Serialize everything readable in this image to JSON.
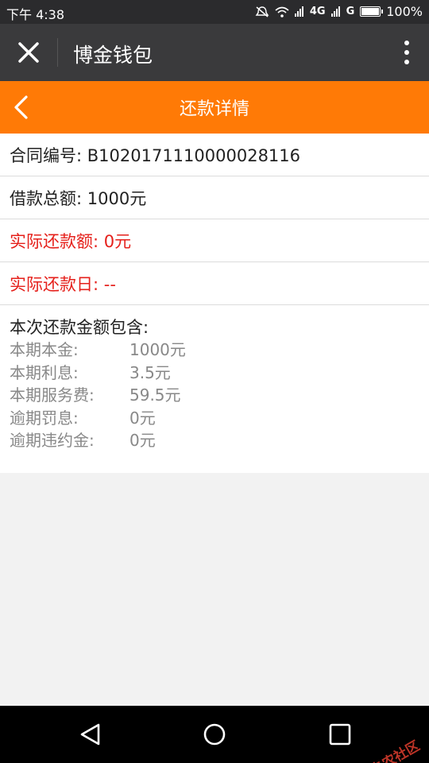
{
  "status_bar": {
    "time": "下午 4:38",
    "network_labels": [
      "4G",
      "G"
    ],
    "battery_level": 1.0,
    "battery_text": "100%"
  },
  "app_bar": {
    "close_icon": "close-icon",
    "title": "博金钱包",
    "more_icon": "more-vertical-icon"
  },
  "page_header": {
    "back_icon": "chevron-left-icon",
    "title": "还款详情",
    "color": "#ff7a06"
  },
  "details": {
    "contract": "合同编号: B1020171110000028116",
    "loan_total": "借款总额: 1000元",
    "actual_amount": "实际还款额: 0元",
    "actual_date": "实际还款日: --",
    "highlight_color": "#e5201b"
  },
  "breakdown": {
    "heading": "本次还款金额包含:",
    "items": [
      {
        "label": "本期本金:",
        "value": "1000元"
      },
      {
        "label": "本期利息:",
        "value": "3.5元"
      },
      {
        "label": "本期服务费:",
        "value": "59.5元"
      },
      {
        "label": "逾期罚息:",
        "value": "0元"
      },
      {
        "label": "逾期违约金:",
        "value": "0元"
      }
    ]
  },
  "nav_bar": {
    "icons": [
      "back-triangle-icon",
      "home-circle-icon",
      "recents-square-icon"
    ]
  },
  "watermark": {
    "text": "卡农社区"
  }
}
